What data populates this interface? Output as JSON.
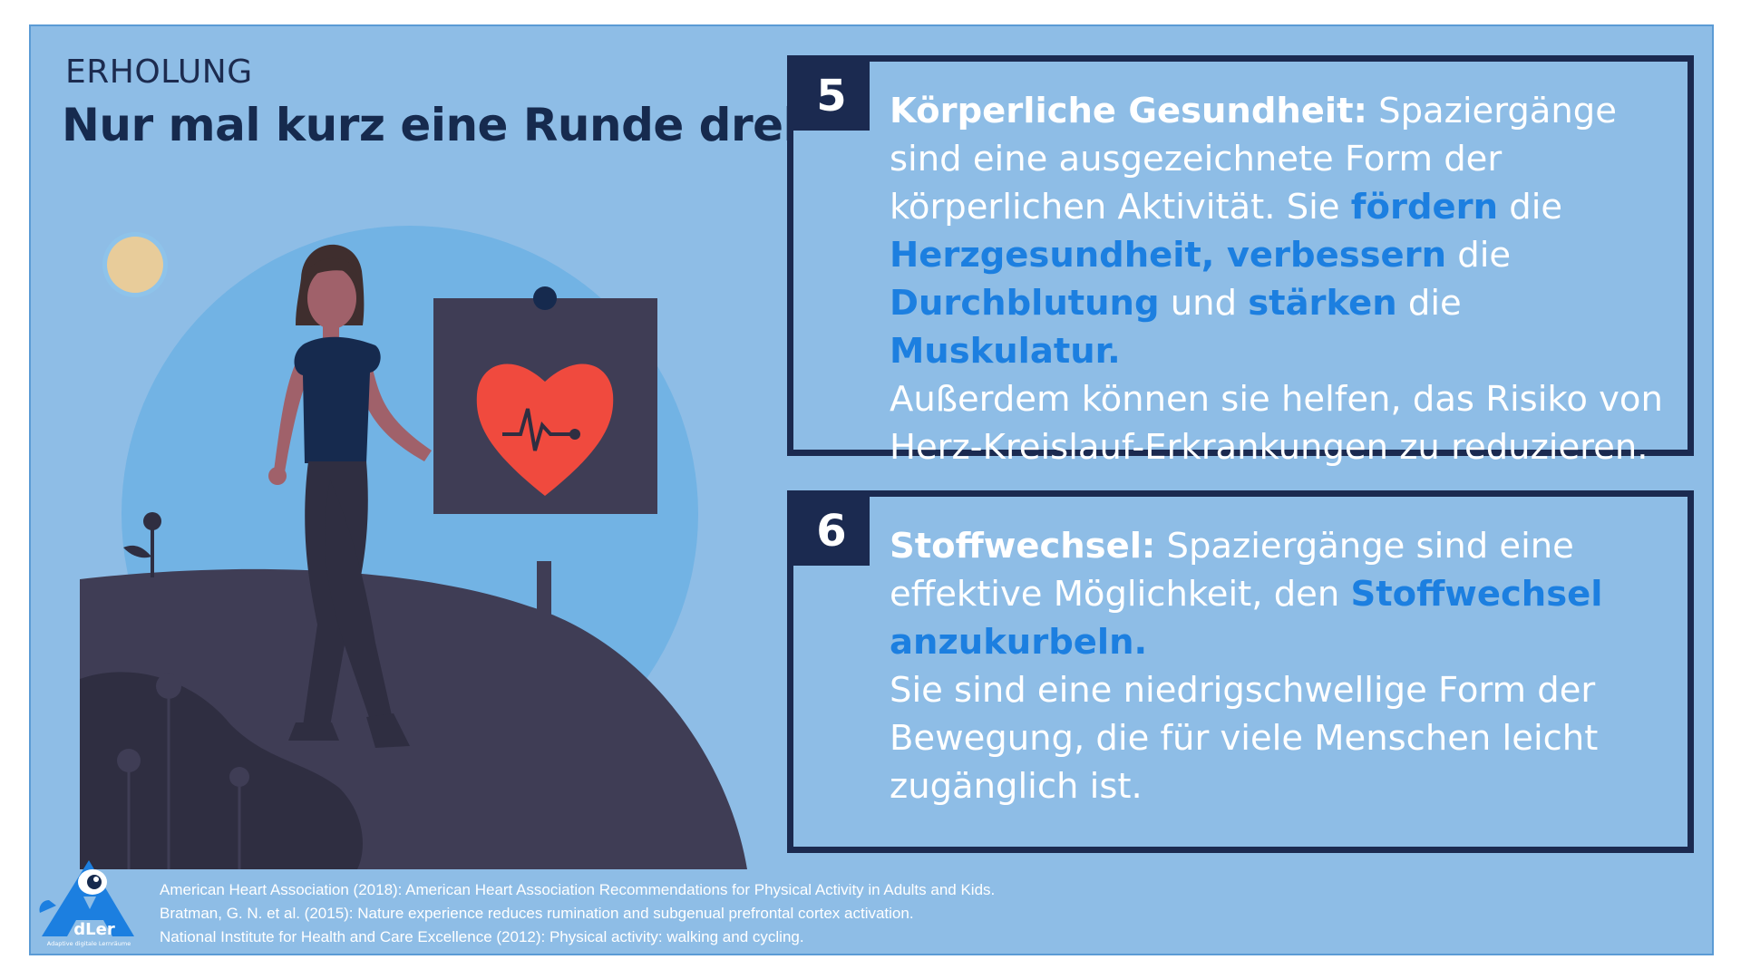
{
  "header": {
    "section_label": "ERHOLUNG",
    "title": "Nur mal kurz eine Runde drehen"
  },
  "cards": [
    {
      "number": "5",
      "heading": "Körperliche Gesundheit:",
      "t1": " Spaziergänge sind eine ausgezeichnete Form der körperlichen Aktivität. Sie ",
      "h1": "fördern",
      "t2": " die ",
      "h2": "Herzgesundheit, verbessern",
      "t3": " die ",
      "h3": "Durchblutung",
      "t4": " und ",
      "h4": "stärken",
      "t5": " die ",
      "h5": "Muskulatur.",
      "extra": "Außerdem können sie helfen, das Risiko von Herz-Kreislauf-Erkrankungen zu reduzieren."
    },
    {
      "number": "6",
      "heading": "Stoffwechsel:",
      "t1": " Spaziergänge sind eine effektive Möglichkeit, den ",
      "h1": "Stoffwechsel anzukurbeln.",
      "extra": "Sie sind eine niedrigschwellige Form der Bewegung, die für viele Menschen leicht zugänglich ist."
    }
  ],
  "logo": {
    "letters": "dLer",
    "subtitle": "Adaptive digitale Lernräume"
  },
  "references": [
    "American Heart Association (2018): American Heart Association Recommendations for Physical Activity in Adults and Kids.",
    "Bratman, G. N. et al. (2015): Nature experience reduces rumination and subgenual prefrontal cortex activation.",
    "National Institute for Health and Care Excellence (2012): Physical activity: walking and cycling."
  ],
  "colors": {
    "background": "#8ebde6",
    "navy": "#1b2a50",
    "highlight": "#1c7fe0",
    "heart": "#f04a3e",
    "sun": "#e8cc9a"
  }
}
